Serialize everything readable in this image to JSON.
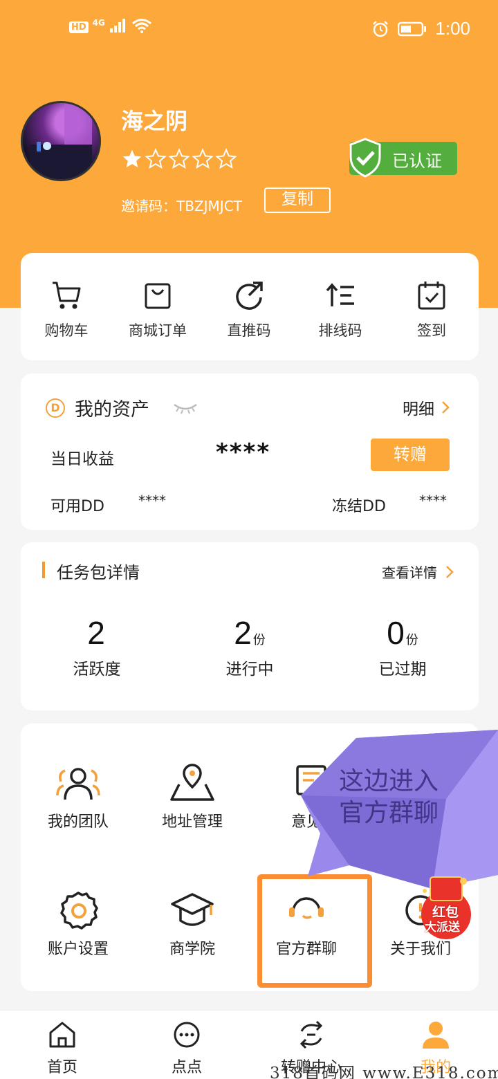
{
  "status_bar": {
    "network_badge": "HD",
    "network_type": "4G",
    "time": "1:00"
  },
  "profile": {
    "username": "海之阴",
    "rating": {
      "filled": 1,
      "total": 5
    },
    "verified_label": "已认证",
    "invite_code_text": "邀请码：TBZJMJCT",
    "copy_label": "复制"
  },
  "quick_menu": [
    {
      "label": "购物车",
      "icon": "cart-icon"
    },
    {
      "label": "商城订单",
      "icon": "shopping-bag-icon"
    },
    {
      "label": "直推码",
      "icon": "share-arrow-icon"
    },
    {
      "label": "排线码",
      "icon": "sort-list-icon"
    },
    {
      "label": "签到",
      "icon": "calendar-check-icon"
    }
  ],
  "assets": {
    "title": "我的资产",
    "detail_label": "明细",
    "daily_income_label": "当日收益",
    "daily_income_value": "****",
    "transfer_label": "转赠",
    "available_label": "可用DD",
    "available_value": "****",
    "frozen_label": "冻结DD",
    "frozen_value": "****"
  },
  "tasks": {
    "title": "任务包详情",
    "view_details_label": "查看详情",
    "stats": [
      {
        "value": "2",
        "unit": "",
        "label": "活跃度"
      },
      {
        "value": "2",
        "unit": "份",
        "label": "进行中"
      },
      {
        "value": "0",
        "unit": "份",
        "label": "已过期"
      }
    ]
  },
  "services": [
    {
      "label": "我的团队",
      "icon": "team-icon"
    },
    {
      "label": "地址管理",
      "icon": "location-pin-icon"
    },
    {
      "label": "意见",
      "icon": "feedback-icon"
    },
    {
      "label": "账户设置",
      "icon": "gear-icon"
    },
    {
      "label": "商学院",
      "icon": "graduation-cap-icon"
    },
    {
      "label": "官方群聊",
      "icon": "headset-icon"
    },
    {
      "label": "关于我们",
      "icon": "info-icon"
    }
  ],
  "callout": {
    "line1": "这边进入",
    "line2": "官方群聊"
  },
  "red_packet": {
    "line1": "红包",
    "line2": "大派送"
  },
  "bottom_nav": [
    {
      "label": "首页",
      "icon": "home-icon"
    },
    {
      "label": "点点",
      "icon": "dots-icon"
    },
    {
      "label": "转赠中心",
      "icon": "transfer-icon"
    },
    {
      "label": "我的",
      "icon": "profile-icon",
      "active": true
    }
  ],
  "watermark": "318首码网 www.E318.com",
  "colors": {
    "accent": "#fda83a",
    "verified": "#54ae3d",
    "highlight": "#fb8d33",
    "callout": "#8b79e0"
  }
}
